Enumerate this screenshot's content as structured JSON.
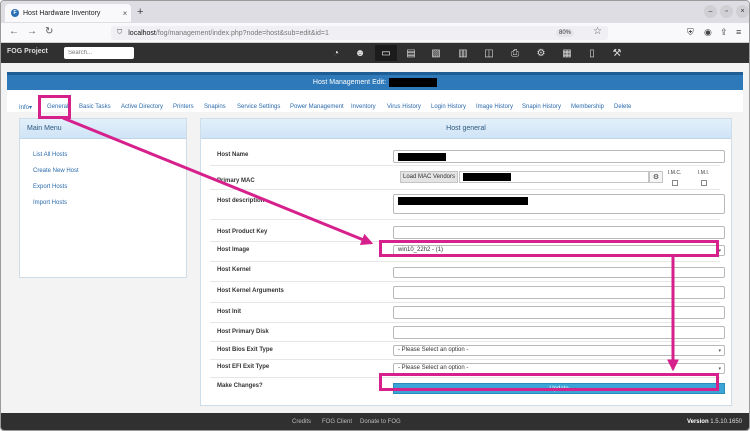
{
  "browser": {
    "tab_title": "Host Hardware Inventory",
    "tab_close": "×",
    "new_tab": "+",
    "url_host": "localhost",
    "url_path": "/fog/management/index.php?node=host&sub=edit&id=1",
    "zoom": "80%"
  },
  "app": {
    "brand": "FOG Project",
    "search_placeholder": "Search..."
  },
  "page": {
    "title_prefix": "Host Management Edit:",
    "tabs": [
      "Info▾",
      "General",
      "Basic Tasks",
      "Active Directory",
      "Printers",
      "Snapins",
      "Service Settings",
      "Power Management",
      "Inventory",
      "Virus History",
      "Login History",
      "Image History",
      "Snapin History",
      "Membership",
      "Delete"
    ],
    "active_tab": "General"
  },
  "main_menu": {
    "title": "Main Menu",
    "items": [
      "List All Hosts",
      "Create New Host",
      "Export Hosts",
      "Import Hosts"
    ]
  },
  "form": {
    "title": "Host general",
    "labels": {
      "host_name": "Host Name",
      "primary_mac": "Primary MAC",
      "host_description": "Host description",
      "product_key": "Host Product Key",
      "image": "Host Image",
      "kernel": "Host Kernel",
      "kernel_args": "Host Kernel Arguments",
      "init": "Host Init",
      "primary_disk": "Host Primary Disk",
      "bios_exit": "Host Bios Exit Type",
      "efi_exit": "Host EFI Exit Type",
      "make_changes": "Make Changes?"
    },
    "load_mac_vendors": "Load MAC Vendors",
    "imc_label": "I.M.C.",
    "imi_label": "I.M.I.",
    "image_value": "win10_22h2 - (1)",
    "bios_exit_value": "- Please Select an option -",
    "efi_exit_value": "- Please Select an option -",
    "update_label": "Update"
  },
  "footer": {
    "links": [
      "Credits",
      "FOG Client",
      "Donate to FOG"
    ],
    "version_label": "Version",
    "version": "1.5.10.1650"
  },
  "colors": {
    "highlight": "#d6208c",
    "banner": "#2e79b9",
    "appbar": "#303030",
    "update_button": "#3aa5d6"
  }
}
